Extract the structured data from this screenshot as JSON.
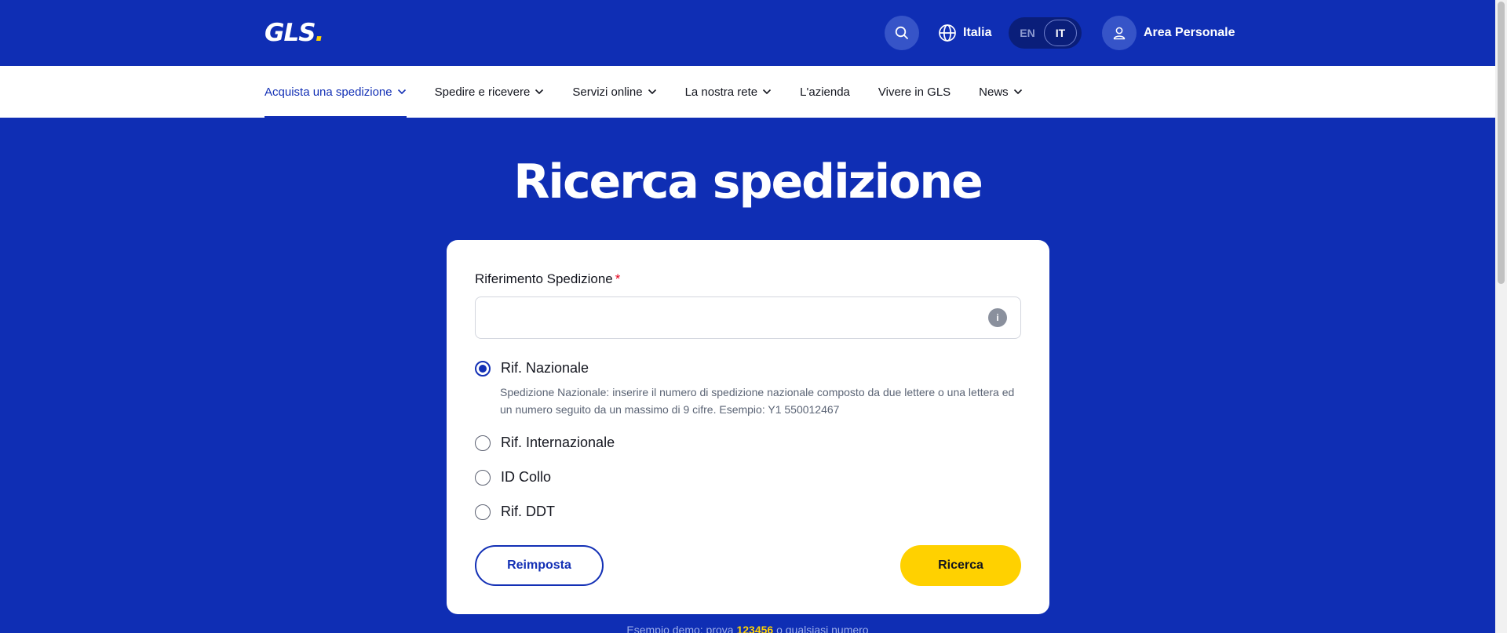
{
  "header": {
    "logo_text": "GLS",
    "logo_dot": ".",
    "country": "Italia",
    "languages": [
      "EN",
      "IT"
    ],
    "active_language": "IT",
    "account_label": "Area Personale"
  },
  "nav": {
    "items": [
      {
        "label": "Acquista una spedizione",
        "active": true,
        "dropdown": true
      },
      {
        "label": "Spedire e ricevere",
        "dropdown": true
      },
      {
        "label": "Servizi online",
        "dropdown": true
      },
      {
        "label": "La nostra rete",
        "dropdown": true
      },
      {
        "label": "L'azienda",
        "dropdown": false
      },
      {
        "label": "Vivere in GLS",
        "dropdown": false
      },
      {
        "label": "News",
        "dropdown": true
      }
    ]
  },
  "main": {
    "title": "Ricerca spedizione",
    "form": {
      "field_label": "Riferimento Spedizione",
      "required_mark": "*",
      "input_value": "",
      "info_icon": "i",
      "options": [
        {
          "label": "Rif. Nazionale",
          "checked": true
        },
        {
          "label": "Rif. Internazionale",
          "checked": false
        },
        {
          "label": "ID Collo",
          "checked": false
        },
        {
          "label": "Rif. DDT",
          "checked": false
        }
      ],
      "help_text": "Spedizione Nazionale: inserire il numero di spedizione nazionale composto da due lettere o una lettera ed un numero seguito da un massimo di 9 cifre. Esempio: Y1 550012467",
      "reset_label": "Reimposta",
      "search_label": "Ricerca"
    },
    "demo_hint": {
      "prefix": "Esempio demo: prova",
      "code": "123456",
      "suffix": "o qualsiasi numero"
    }
  },
  "colors": {
    "brand_blue": "#0f2eb4",
    "accent_yellow": "#ffd100",
    "required_red": "#e3001b"
  }
}
